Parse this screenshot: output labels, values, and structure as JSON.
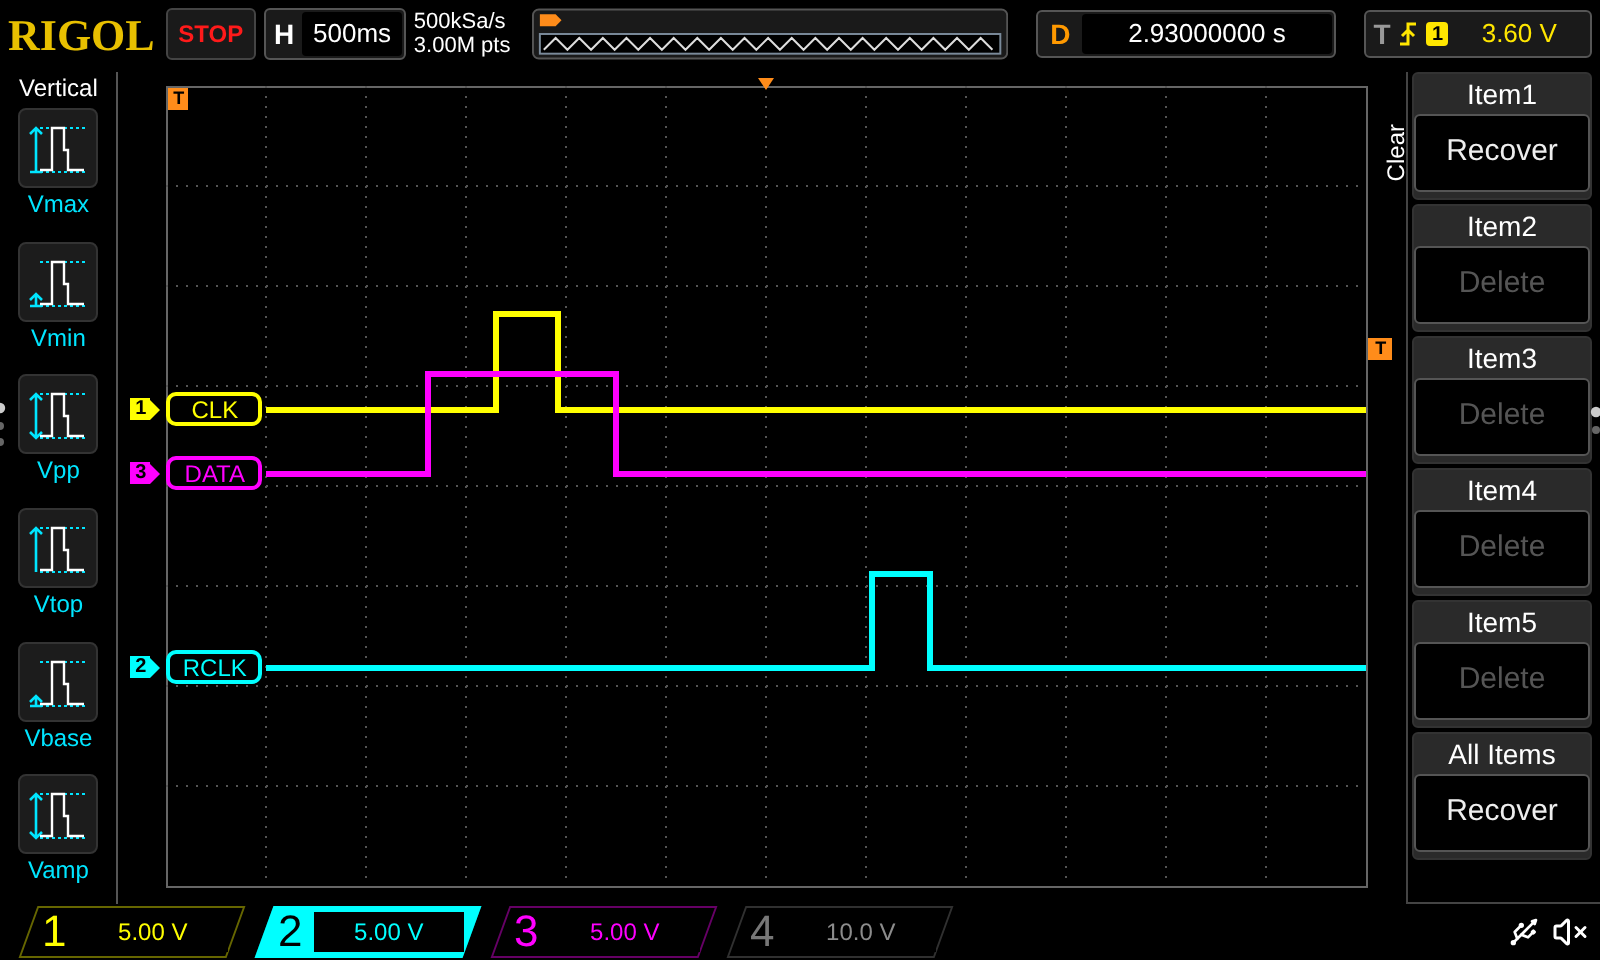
{
  "top_bar": {
    "logo": "RIGOL",
    "run_state": "STOP",
    "horizontal": {
      "label": "H",
      "value": "500ms"
    },
    "sample_rate": "500kSa/s",
    "memory_depth": "3.00M pts",
    "delay": {
      "label": "D",
      "value": "2.93000000 s"
    },
    "trigger": {
      "label": "T",
      "source": "1",
      "level": "3.60 V"
    }
  },
  "measure_panel": {
    "title": "Vertical",
    "items": [
      {
        "label": "Vmax",
        "kind": "max"
      },
      {
        "label": "Vmin",
        "kind": "min"
      },
      {
        "label": "Vpp",
        "kind": "pp"
      },
      {
        "label": "Vtop",
        "kind": "top"
      },
      {
        "label": "Vbase",
        "kind": "base"
      },
      {
        "label": "Vamp",
        "kind": "amp"
      }
    ]
  },
  "waveform": {
    "trigger_position_marker": "T",
    "trigger_level_marker": "T",
    "channels": [
      {
        "number": "1",
        "label": "CLK",
        "color": "#ffff00"
      },
      {
        "number": "3",
        "label": "DATA",
        "color": "#ff00ff"
      },
      {
        "number": "2",
        "label": "RCLK",
        "color": "#00ffff"
      }
    ]
  },
  "clear_menu": {
    "title": "Clear",
    "items": [
      {
        "name": "Item1",
        "action": "Recover",
        "disabled": false
      },
      {
        "name": "Item2",
        "action": "Delete",
        "disabled": true
      },
      {
        "name": "Item3",
        "action": "Delete",
        "disabled": true
      },
      {
        "name": "Item4",
        "action": "Delete",
        "disabled": true
      },
      {
        "name": "Item5",
        "action": "Delete",
        "disabled": true
      },
      {
        "name": "All Items",
        "action": "Recover",
        "disabled": false
      }
    ]
  },
  "channel_bar": [
    {
      "number": "1",
      "scale": "5.00 V",
      "color": "#ffff00",
      "selected": false,
      "enabled": true
    },
    {
      "number": "2",
      "scale": "5.00 V",
      "color": "#00ffff",
      "selected": true,
      "enabled": true
    },
    {
      "number": "3",
      "scale": "5.00 V",
      "color": "#ff00ff",
      "selected": false,
      "enabled": true
    },
    {
      "number": "4",
      "scale": "10.0 V",
      "color": "#777777",
      "selected": false,
      "enabled": false
    }
  ]
}
